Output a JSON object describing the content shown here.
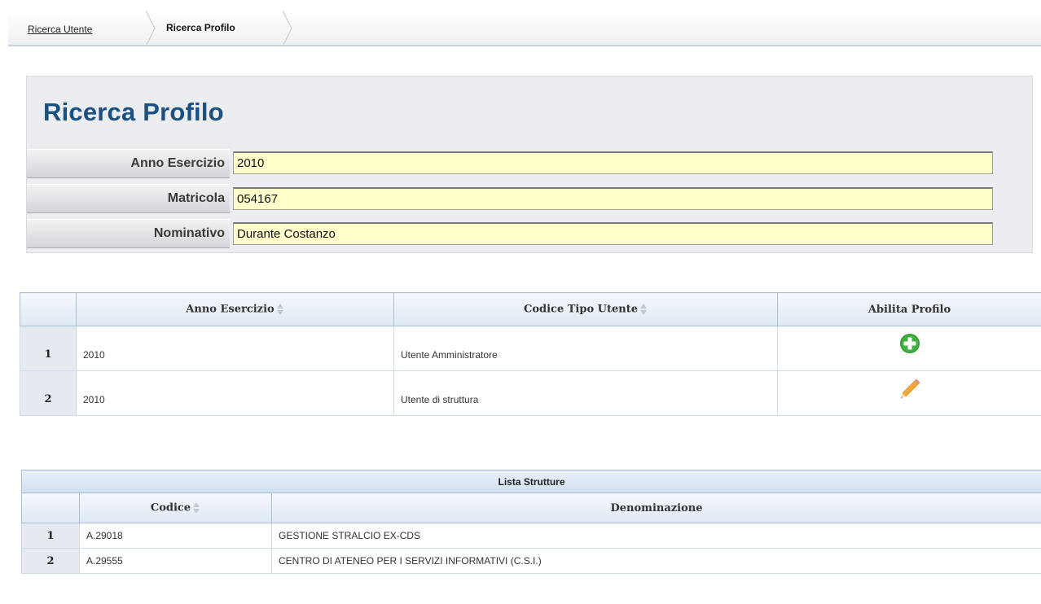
{
  "breadcrumb": {
    "items": [
      {
        "label": "Ricerca Utente"
      },
      {
        "label": "Ricerca Profilo"
      }
    ]
  },
  "form": {
    "title": "Ricerca Profilo",
    "fields": [
      {
        "label": "Anno Esercizio",
        "value": "2010"
      },
      {
        "label": "Matricola",
        "value": "054167"
      },
      {
        "label": "Nominativo",
        "value": "Durante Costanzo"
      }
    ]
  },
  "results": {
    "headers": {
      "anno": "Anno Esercizio",
      "codice_tipo": "Codice Tipo Utente",
      "abilita": "Abilita Profilo"
    },
    "rows": [
      {
        "num": "1",
        "anno": "2010",
        "tipo": "Utente Amministratore",
        "action_icon": "add-icon"
      },
      {
        "num": "2",
        "anno": "2010",
        "tipo": "Utente di struttura",
        "action_icon": "edit-pencil-icon"
      }
    ]
  },
  "strutture": {
    "caption": "Lista Strutture",
    "headers": {
      "codice": "Codice",
      "denominazione": "Denominazione"
    },
    "rows": [
      {
        "num": "1",
        "codice": "A.29018",
        "denominazione": "GESTIONE STRALCIO EX-CDS"
      },
      {
        "num": "2",
        "codice": "A.29555",
        "denominazione": "CENTRO DI ATENEO PER I SERVIZI INFORMATIVI (C.S.I.)"
      }
    ]
  },
  "colors": {
    "title": "#1a4f82",
    "input_bg": "#ffffcc",
    "add_icon": "#3aa53a",
    "edit_icon": "#f2a53c"
  }
}
